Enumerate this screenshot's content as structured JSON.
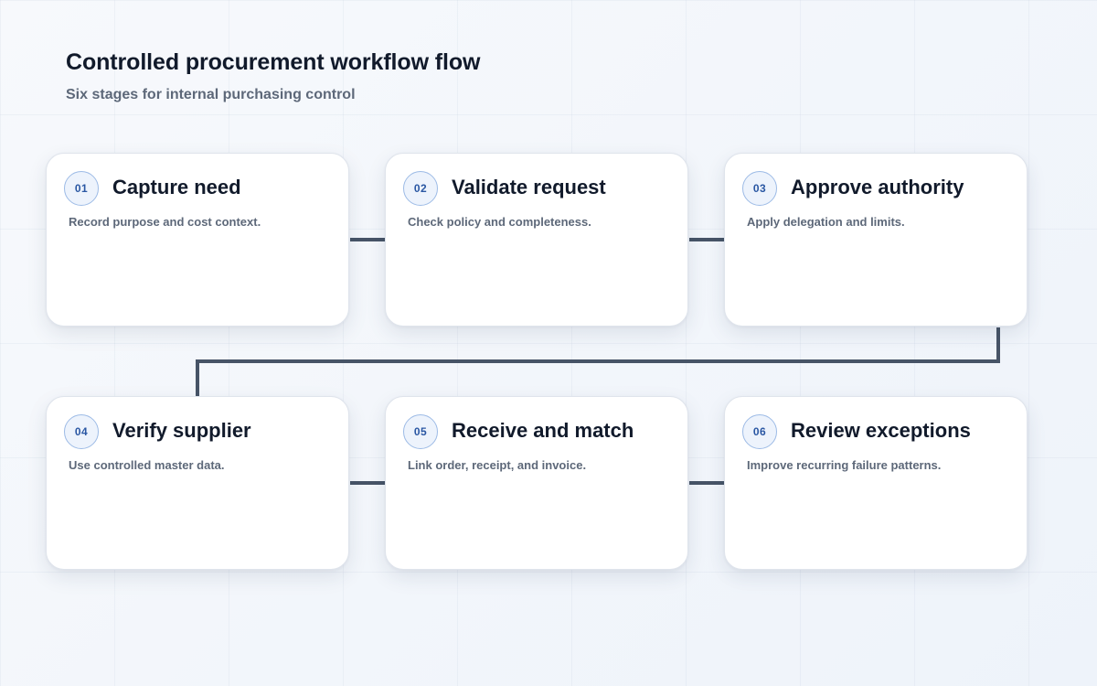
{
  "header": {
    "title": "Controlled procurement workflow flow",
    "subtitle": "Six stages for internal purchasing control"
  },
  "colors": {
    "connector": "#475467",
    "badge_text": "#2a57a3",
    "badge_border": "#9dbbe6",
    "badge_fill": "#edf3fc",
    "title_text": "#111a2b",
    "muted_text": "#5d6879"
  },
  "stages": [
    {
      "number": "01",
      "title": "Capture need",
      "description": "Record purpose and cost context."
    },
    {
      "number": "02",
      "title": "Validate request",
      "description": "Check policy and completeness."
    },
    {
      "number": "03",
      "title": "Approve authority",
      "description": "Apply delegation and limits."
    },
    {
      "number": "04",
      "title": "Verify supplier",
      "description": "Use controlled master data."
    },
    {
      "number": "05",
      "title": "Receive and match",
      "description": "Link order, receipt, and invoice."
    },
    {
      "number": "06",
      "title": "Review exceptions",
      "description": "Improve recurring failure patterns."
    }
  ]
}
